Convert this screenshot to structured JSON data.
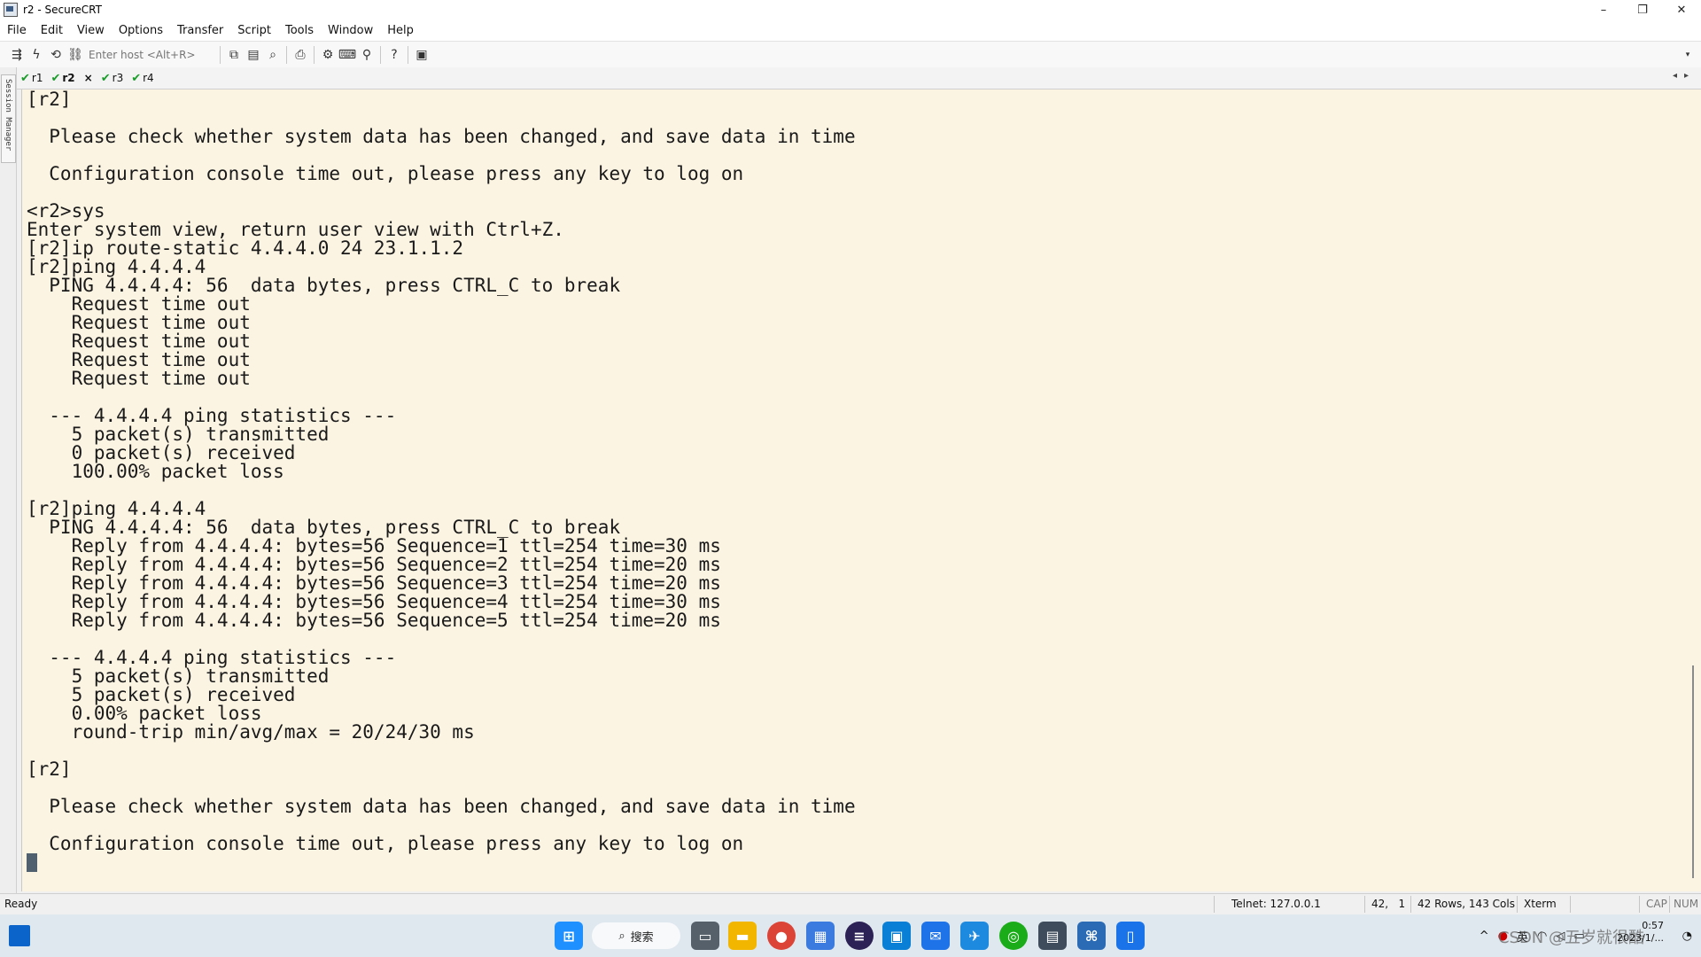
{
  "window": {
    "title": "r2 - SecureCRT",
    "minimize": "–",
    "restore": "❐",
    "close": "✕"
  },
  "menu": [
    "File",
    "Edit",
    "View",
    "Options",
    "Transfer",
    "Script",
    "Tools",
    "Window",
    "Help"
  ],
  "toolbar": {
    "host_placeholder": "Enter host <Alt+R>",
    "icons": [
      "connect-icon",
      "quick-connect-icon",
      "reconnect-icon",
      "disconnect-icon",
      "copy-icon",
      "paste-icon",
      "find-icon",
      "print-icon",
      "settings-icon",
      "keymap-icon",
      "sftp-icon",
      "help-icon",
      "screen-icon"
    ]
  },
  "session_manager": {
    "label": "Session Manager"
  },
  "tabs": [
    {
      "label": "r1",
      "status": "connected",
      "active": false
    },
    {
      "label": "r2",
      "status": "connected",
      "active": true
    },
    {
      "label": "r3",
      "status": "connected",
      "active": false
    },
    {
      "label": "r4",
      "status": "connected",
      "active": false
    }
  ],
  "terminal": {
    "background": "#fcf4e3",
    "lines": [
      "[r2]",
      "",
      "  Please check whether system data has been changed, and save data in time",
      "",
      "  Configuration console time out, please press any key to log on",
      "",
      "<r2>sys",
      "Enter system view, return user view with Ctrl+Z.",
      "[r2]ip route-static 4.4.4.0 24 23.1.1.2",
      "[r2]ping 4.4.4.4",
      "  PING 4.4.4.4: 56  data bytes, press CTRL_C to break",
      "    Request time out",
      "    Request time out",
      "    Request time out",
      "    Request time out",
      "    Request time out",
      "",
      "  --- 4.4.4.4 ping statistics ---",
      "    5 packet(s) transmitted",
      "    0 packet(s) received",
      "    100.00% packet loss",
      "",
      "[r2]ping 4.4.4.4",
      "  PING 4.4.4.4: 56  data bytes, press CTRL_C to break",
      "    Reply from 4.4.4.4: bytes=56 Sequence=1 ttl=254 time=30 ms",
      "    Reply from 4.4.4.4: bytes=56 Sequence=2 ttl=254 time=20 ms",
      "    Reply from 4.4.4.4: bytes=56 Sequence=3 ttl=254 time=20 ms",
      "    Reply from 4.4.4.4: bytes=56 Sequence=4 ttl=254 time=30 ms",
      "    Reply from 4.4.4.4: bytes=56 Sequence=5 ttl=254 time=20 ms",
      "",
      "  --- 4.4.4.4 ping statistics ---",
      "    5 packet(s) transmitted",
      "    5 packet(s) received",
      "    0.00% packet loss",
      "    round-trip min/avg/max = 20/24/30 ms",
      "",
      "[r2]",
      "",
      "  Please check whether system data has been changed, and save data in time",
      "",
      "  Configuration console time out, please press any key to log on"
    ]
  },
  "statusbar": {
    "ready": "Ready",
    "connection": "Telnet: 127.0.0.1",
    "cursor_pos": "42,   1",
    "size": "42 Rows, 143 Cols",
    "emulation": "Xterm",
    "caps": "CAP",
    "num": "NUM"
  },
  "taskbar": {
    "search_label": "搜索",
    "apps": [
      "task-view-icon",
      "file-explorer-icon",
      "chrome-icon",
      "store-icon",
      "eclipse-icon",
      "vmware-icon",
      "mail-app-icon",
      "mail-icon",
      "wechat-icon",
      "securecrt-icon",
      "network-icon",
      "phone-icon"
    ],
    "tray": {
      "lang": "英",
      "watermark": "CSDN @五岁就很酷",
      "time": "0:57",
      "date": "2023/1/..."
    }
  }
}
